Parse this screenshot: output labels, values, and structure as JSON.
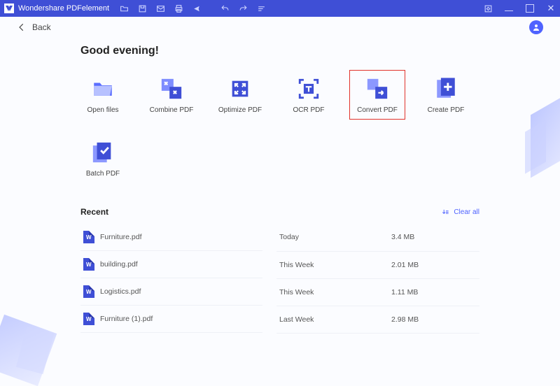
{
  "app": {
    "title": "Wondershare PDFelement"
  },
  "nav": {
    "back_label": "Back"
  },
  "greeting": "Good evening!",
  "tiles": [
    {
      "label": "Open files"
    },
    {
      "label": "Combine PDF"
    },
    {
      "label": "Optimize PDF"
    },
    {
      "label": "OCR PDF"
    },
    {
      "label": "Convert PDF"
    },
    {
      "label": "Create PDF"
    },
    {
      "label": "Batch PDF"
    }
  ],
  "recent": {
    "title": "Recent",
    "clear_label": "Clear all",
    "files": [
      {
        "name": "Furniture.pdf",
        "when": "Today",
        "size": "3.4 MB"
      },
      {
        "name": "building.pdf",
        "when": "This Week",
        "size": "2.01 MB"
      },
      {
        "name": "Logistics.pdf",
        "when": "This Week",
        "size": "1.11 MB"
      },
      {
        "name": "Furniture (1).pdf",
        "when": "Last Week",
        "size": "2.98 MB"
      }
    ]
  }
}
